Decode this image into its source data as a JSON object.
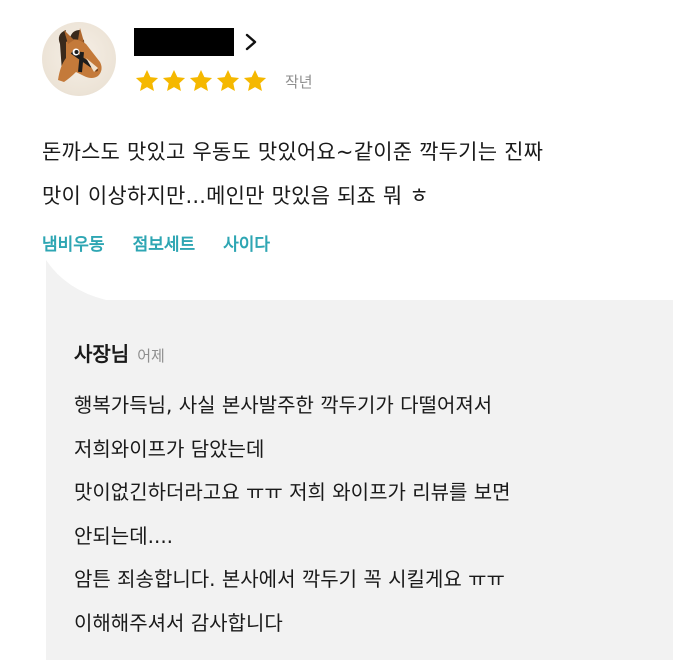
{
  "review": {
    "date": "작년",
    "rating": 5,
    "star_color": "#f5b800",
    "body_lines": [
      "돈까스도 맛있고 우동도 맛있어요~같이준 깍두기는 진짜",
      "맛이 이상하지만...메인만 맛있음 되죠 뭐 ㅎ"
    ],
    "tags": [
      "냄비우동",
      "점보세트",
      "사이다"
    ],
    "tag_color": "#2ea6b3"
  },
  "reply": {
    "author": "사장님",
    "date": "어제",
    "body_lines": [
      "행복가득님, 사실 본사발주한 깍두기가 다떨어져서",
      "저희와이프가 담았는데",
      "맛이없긴하더라고요 ㅠㅠ 저희 와이프가 리뷰를 보면",
      "안되는데....",
      "암튼 죄송합니다. 본사에서 깍두기 꼭 시킬게요 ㅠㅠ",
      "이해해주셔서 감사합니다"
    ],
    "background": "#f2f2f2"
  },
  "icons": {
    "avatar": "horse-avatar-icon",
    "chevron": "chevron-right-icon",
    "star": "star-icon"
  }
}
